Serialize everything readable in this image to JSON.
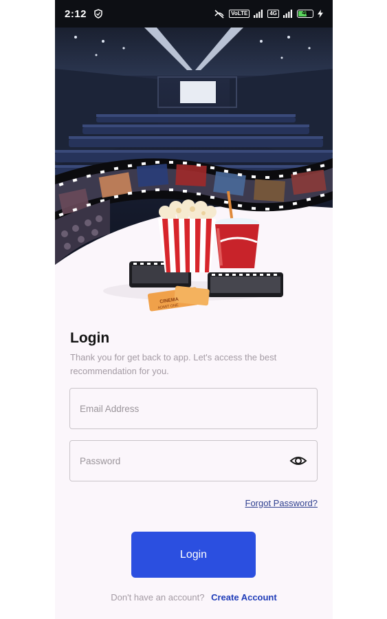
{
  "status_bar": {
    "time": "2:12",
    "battery": "46",
    "net_label_1": "VoLTE",
    "net_label_2": "4G"
  },
  "login": {
    "title": "Login",
    "subtitle": "Thank you for get back to app. Let's access the best recommendation for you.",
    "email_placeholder": "Email Address",
    "password_placeholder": "Password",
    "forgot_label": "Forgot Password?",
    "login_button": "Login",
    "no_account_text": "Don't have an account?",
    "create_account_label": "Create Account"
  },
  "hero": {
    "ticket_text": "CINEMA",
    "ticket_sub": "ADMIT ONE"
  },
  "colors": {
    "accent": "#2b4fe0",
    "link": "#1e3bb8",
    "background": "#fbf6fb"
  }
}
